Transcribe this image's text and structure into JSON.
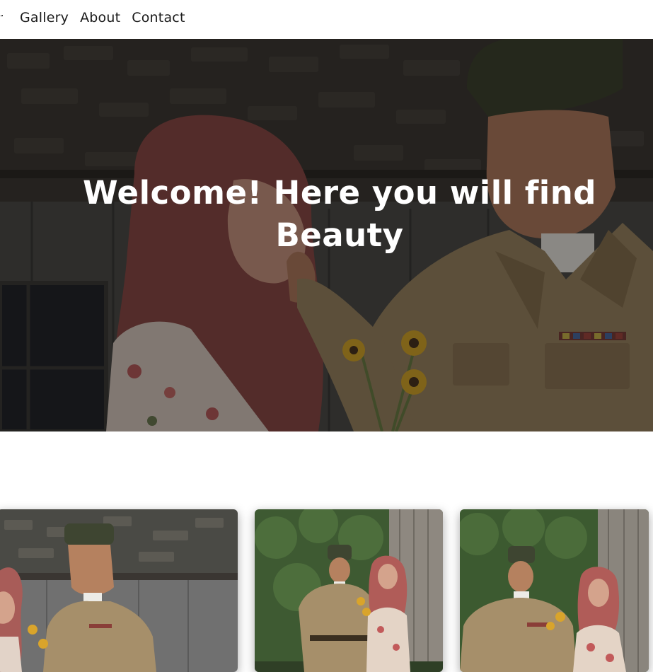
{
  "nav": {
    "links": [
      {
        "label": "Gallery"
      },
      {
        "label": "About"
      },
      {
        "label": "Contact"
      }
    ]
  },
  "hero": {
    "title": "Welcome! Here you will find Beauty",
    "overlay_color": "#000000"
  },
  "gallery": {
    "cards": [
      {
        "subject": "soldier-and-woman-photo"
      },
      {
        "subject": "couple-portrait-photo"
      },
      {
        "subject": "couple-portrait-photo"
      }
    ]
  },
  "colors": {
    "nav_text": "#1a1a1a",
    "hero_text": "#ffffff",
    "background": "#ffffff"
  }
}
